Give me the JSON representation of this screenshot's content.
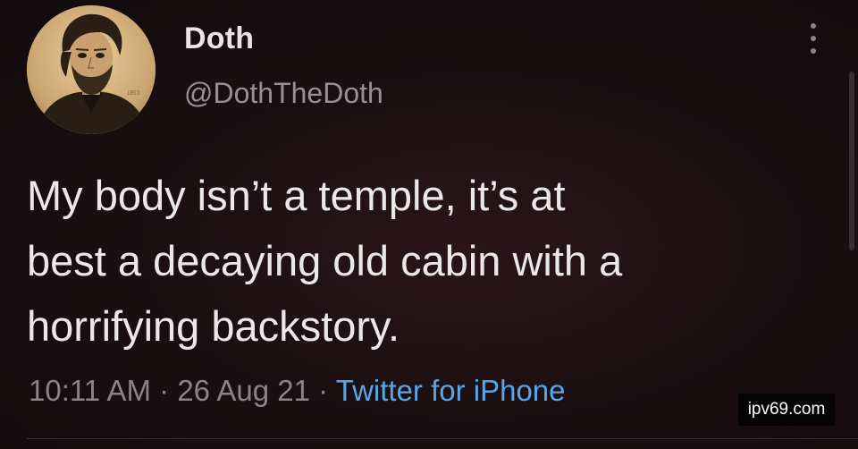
{
  "header": {
    "display_name": "Doth",
    "handle": "@DothTheDoth",
    "more_icon": "more-vertical-icon"
  },
  "tweet": {
    "lines": [
      "My body isn’t a temple, it’s at",
      "best a decaying old cabin with a",
      "horrifying backstory."
    ]
  },
  "meta": {
    "time": "10:11 AM",
    "separator": "·",
    "date": "26 Aug 21",
    "source": "Twitter for iPhone"
  },
  "watermark": "ipv69.com",
  "colors": {
    "background": "#1c0f12",
    "text": "#ece7e9",
    "muted": "#8c8287",
    "link": "#58a6e7"
  }
}
